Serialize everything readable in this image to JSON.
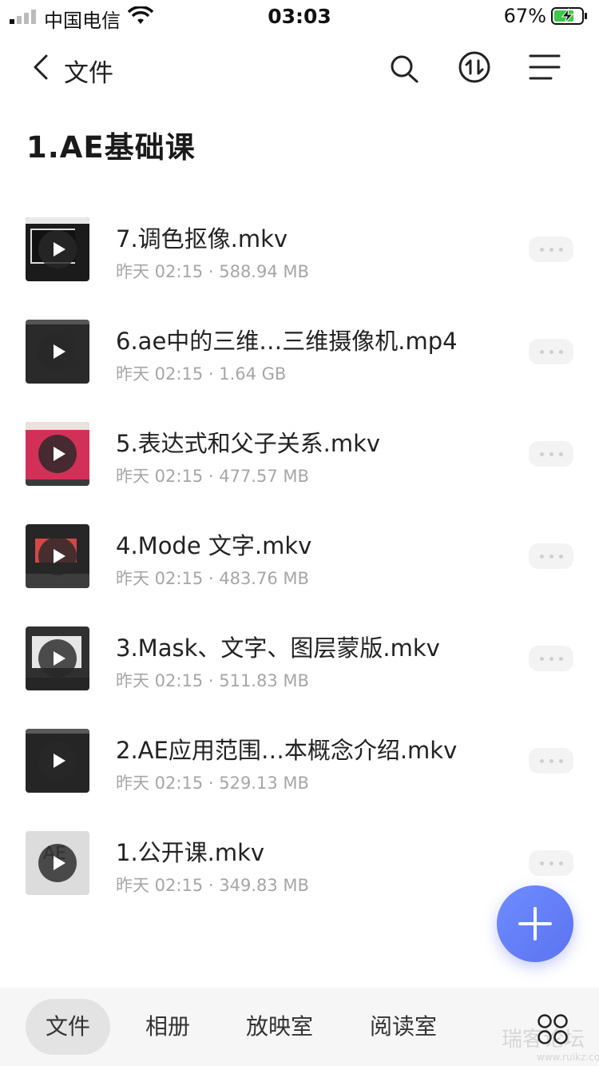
{
  "status_bar": {
    "carrier": "中国电信",
    "time": "03:03",
    "battery": "67%"
  },
  "nav": {
    "title": "文件"
  },
  "folder": {
    "title": "1.AE基础课"
  },
  "files": [
    {
      "name": "7.调色抠像.mkv",
      "meta": "昨天 02:15 · 588.94 MB"
    },
    {
      "name": " 6.ae中的三维…三维摄像机.mp4",
      "meta": "昨天 02:15 · 1.64 GB"
    },
    {
      "name": "5.表达式和父子关系.mkv",
      "meta": "昨天 02:15 · 477.57 MB"
    },
    {
      "name": "4.Mode 文字.mkv",
      "meta": "昨天 02:15 · 483.76 MB"
    },
    {
      "name": "3.Mask、文字、图层蒙版.mkv",
      "meta": "昨天 02:15 · 511.83 MB"
    },
    {
      "name": " 2.AE应用范围…本概念介绍.mkv",
      "meta": "昨天 02:15 · 529.13 MB"
    },
    {
      "name": "1.公开课.mkv",
      "meta": "昨天 02:15 · 349.83 MB",
      "thumb_text": "AE"
    }
  ],
  "tab_bar": {
    "tabs": [
      "文件",
      "相册",
      "放映室",
      "阅读室"
    ],
    "active": "文件",
    "watermark": "瑞客论坛",
    "watermark_url": "www.ruikz.com"
  },
  "colors": {
    "fab": "#5b73f0",
    "tab_bar_bg": "#f6f6f6"
  }
}
